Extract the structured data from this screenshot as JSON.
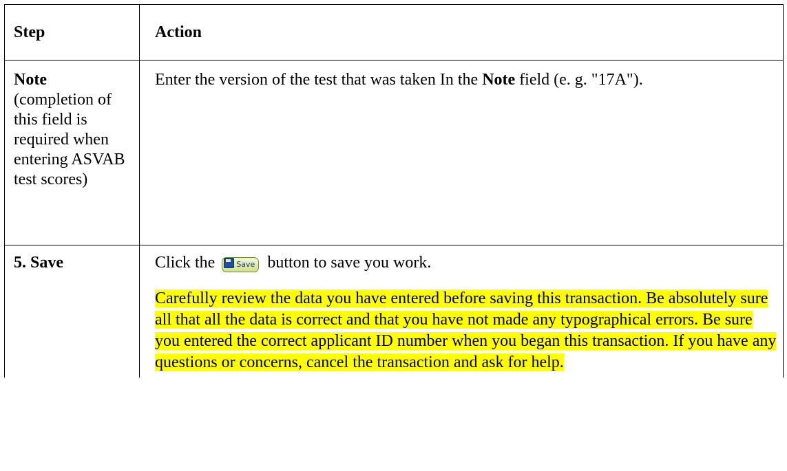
{
  "table": {
    "headers": {
      "step": "Step",
      "action": "Action"
    },
    "rows": [
      {
        "step_title": "Note",
        "step_note": "(completion of this field is required when entering ASVAB test scores)",
        "action_text_1": "Enter the version of the test that was taken In the ",
        "action_bold": "Note",
        "action_text_2": " field (e. g. \"17A\")."
      },
      {
        "step_title": "5. Save",
        "action_before_button": "Click the ",
        "button_label": "Save",
        "button_icon": "floppy-disk-icon",
        "action_after_button": " button to save you work.",
        "highlight_text": "Carefully review the data you have entered before saving this transaction.  Be absolutely sure all that all the data is correct and that you have not made any typographical errors.  Be sure you entered the correct applicant ID number when you began this transaction.  If you have any questions or concerns, cancel the transaction and ask for help.",
        "highlight_color": "#ffff00"
      }
    ]
  }
}
